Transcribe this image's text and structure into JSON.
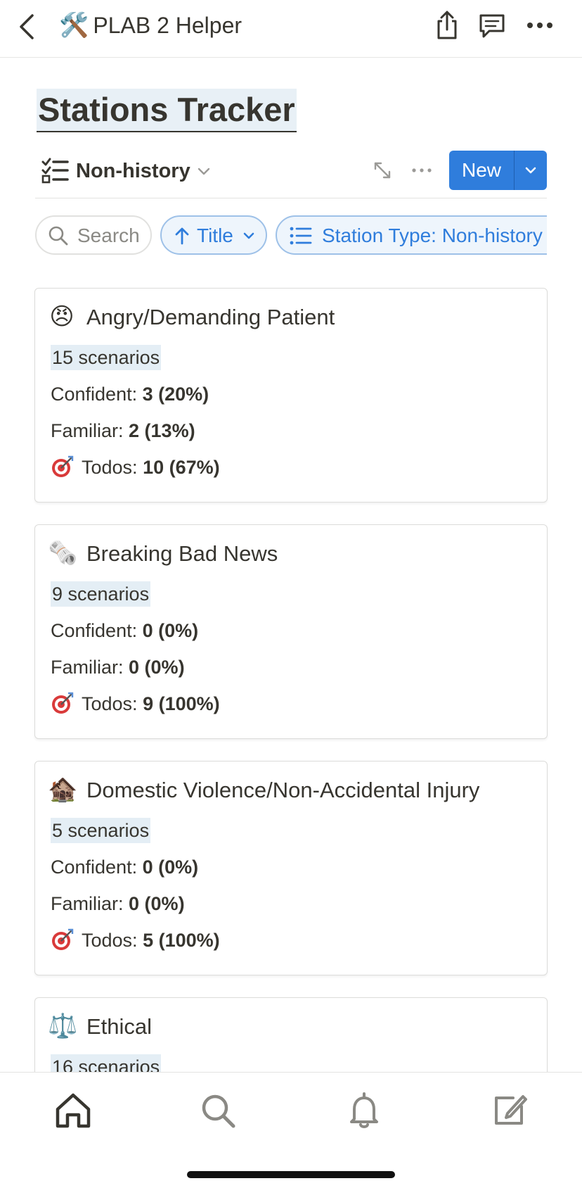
{
  "header": {
    "app_emoji": "🛠️",
    "app_title": "PLAB 2 Helper",
    "icons": [
      "back-icon",
      "share-icon",
      "comment-icon",
      "more-icon"
    ]
  },
  "page": {
    "title": "Stations Tracker"
  },
  "view": {
    "name": "Non-history",
    "new_label": "New"
  },
  "filters": {
    "search_label": "Search",
    "sort_label": "Title",
    "filter_label": "Station Type: Non-history"
  },
  "cards": [
    {
      "emoji": "😠",
      "title": "Angry/Demanding Patient",
      "count": "15 scenarios",
      "confident_label": "Confident:",
      "confident_value": "3 (20%)",
      "familiar_label": "Familiar:",
      "familiar_value": "2 (13%)",
      "todos_label": "Todos:",
      "todos_value": "10 (67%)"
    },
    {
      "emoji": "🗞️",
      "title": "Breaking Bad News",
      "count": "9 scenarios",
      "confident_label": "Confident:",
      "confident_value": "0 (0%)",
      "familiar_label": "Familiar:",
      "familiar_value": "0 (0%)",
      "todos_label": "Todos:",
      "todos_value": "9 (100%)"
    },
    {
      "emoji": "🏚️",
      "title": "Domestic Violence/Non-Accidental Injury",
      "count": "5 scenarios",
      "confident_label": "Confident:",
      "confident_value": "0 (0%)",
      "familiar_label": "Familiar:",
      "familiar_value": "0 (0%)",
      "todos_label": "Todos:",
      "todos_value": "5 (100%)"
    },
    {
      "emoji": "⚖️",
      "title": "Ethical",
      "count": "16 scenarios"
    }
  ],
  "bottom_nav": {
    "icons": [
      "home-icon",
      "search-icon",
      "bell-icon",
      "compose-icon"
    ]
  },
  "colors": {
    "accent": "#2f7ddc",
    "highlight": "#e4eef5",
    "text": "#37352f"
  }
}
